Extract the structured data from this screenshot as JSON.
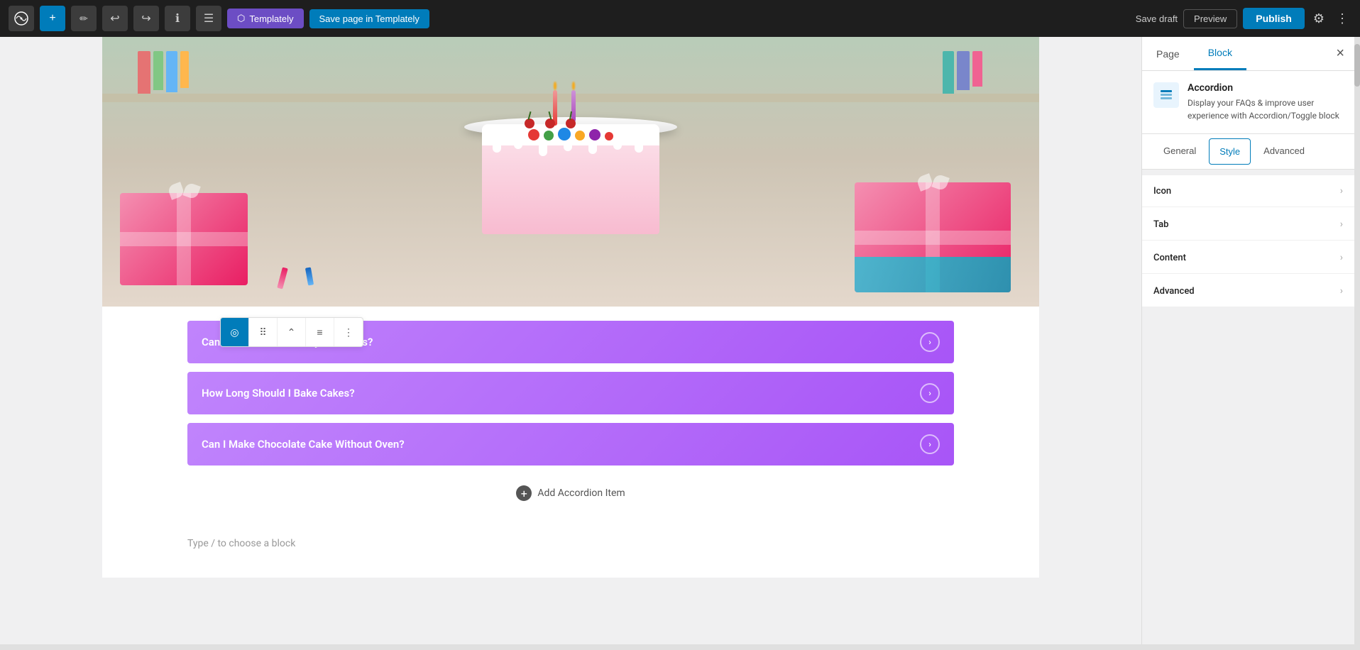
{
  "toolbar": {
    "wp_logo": "W",
    "add_label": "+",
    "pen_label": "✎",
    "undo_label": "↩",
    "redo_label": "↪",
    "info_label": "ℹ",
    "list_label": "☰",
    "templately_btn": "Templately",
    "save_templately_btn": "Save page in Templately",
    "save_draft_label": "Save draft",
    "preview_label": "Preview",
    "publish_label": "Publish",
    "settings_icon": "⚙",
    "menu_icon": "⋮"
  },
  "sidebar": {
    "tab_page": "Page",
    "tab_block": "Block",
    "close_icon": "×",
    "block_icon": "☰",
    "block_title": "Accordion",
    "block_description": "Display your FAQs & improve user experience with Accordion/Toggle block",
    "settings_tab_general": "General",
    "settings_tab_style": "Style",
    "settings_tab_advanced": "Advanced",
    "panel_icon": "Icon",
    "panel_tab": "Tab",
    "panel_content": "Content",
    "panel_advanced": "Advanced",
    "chevron": "›"
  },
  "accordion": {
    "item1": "Can I use Vanilla Directly On Cakes?",
    "item2": "How Long Should I Bake Cakes?",
    "item3": "Can I Make Chocolate Cake Without Oven?",
    "add_item": "Add Accordion Item",
    "arrow": "›"
  },
  "editor": {
    "type_hint": "Type / to choose a block"
  },
  "block_toolbar": {
    "icon1": "◎",
    "icon2": "⠿",
    "icon3": "⌃",
    "icon4": "≡",
    "icon5": "⋮"
  }
}
